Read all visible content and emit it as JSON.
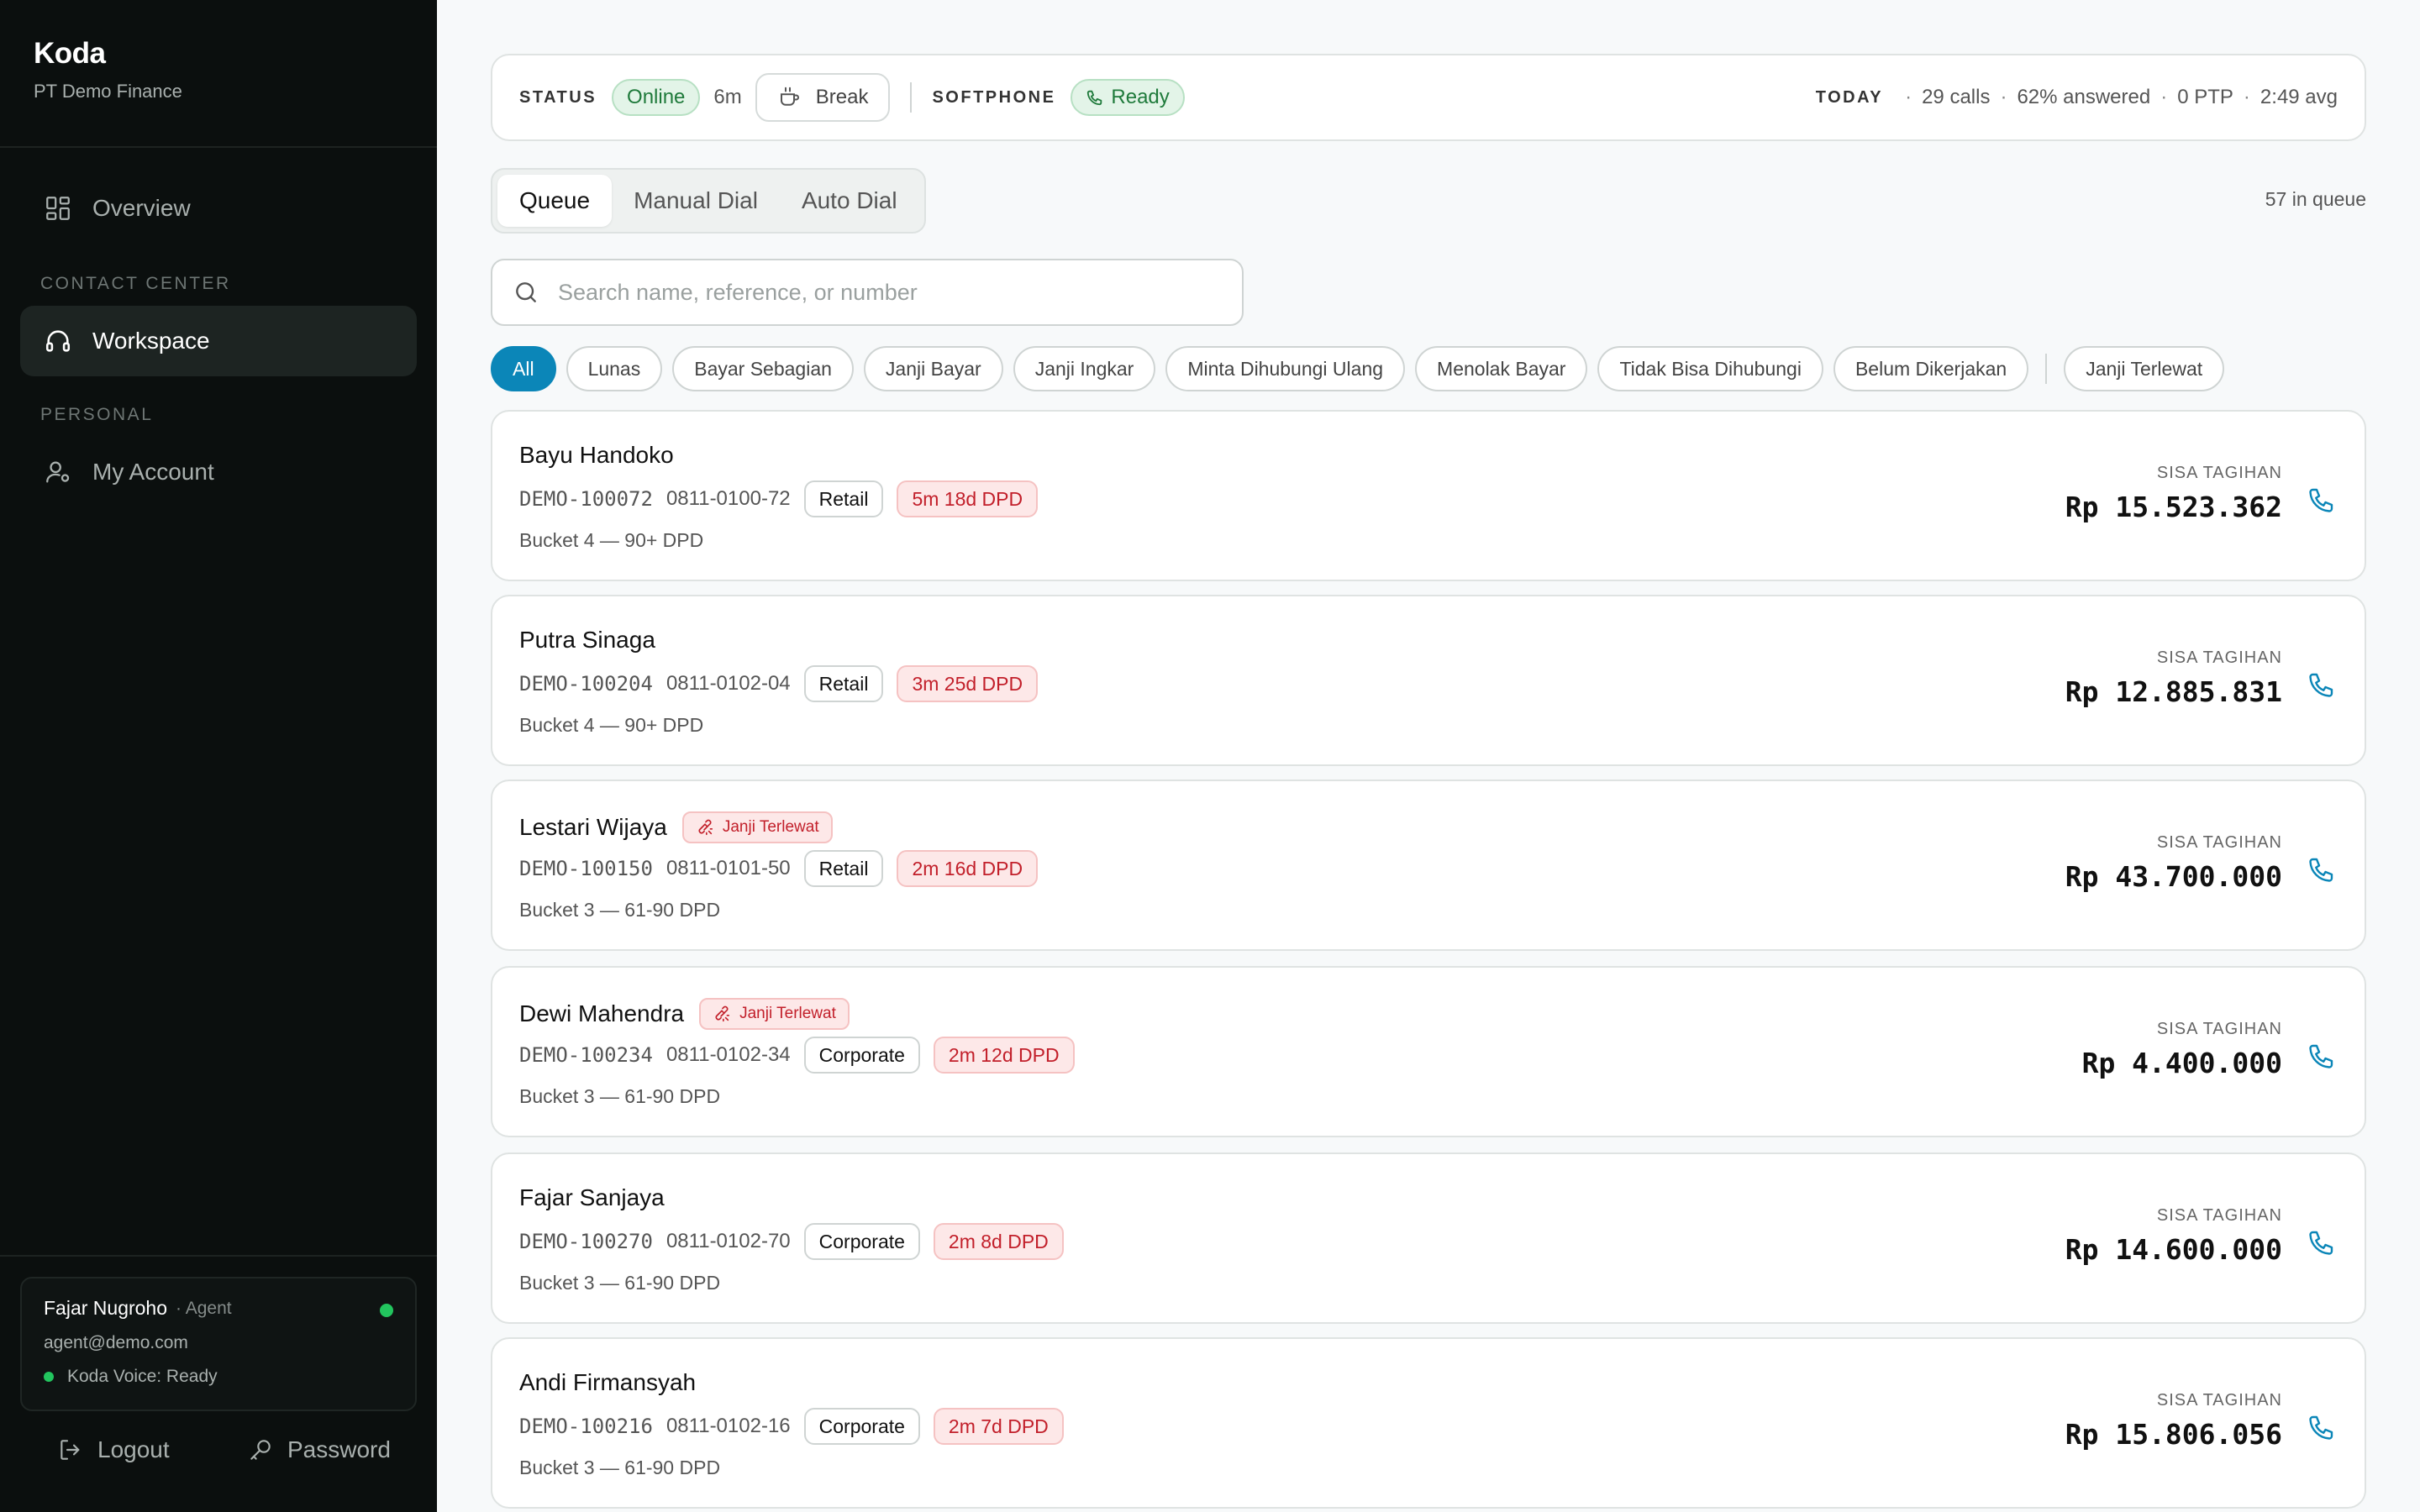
{
  "sidebar": {
    "brand": "Koda",
    "org": "PT Demo Finance",
    "overview": "Overview",
    "section_contact": "CONTACT CENTER",
    "workspace": "Workspace",
    "section_personal": "PERSONAL",
    "account": "My Account",
    "user": {
      "name": "Fajar Nugroho",
      "role": "· Agent",
      "email": "agent@demo.com",
      "voice": "Koda Voice: Ready"
    },
    "logout": "Logout",
    "password": "Password"
  },
  "status": {
    "status_label": "STATUS",
    "online": "Online",
    "duration": "6m",
    "break": "Break",
    "softphone_label": "SOFTPHONE",
    "ready": "Ready",
    "today_label": "TODAY",
    "calls": "29 calls",
    "answered": "62% answered",
    "ptp": "0 PTP",
    "avg": "2:49 avg"
  },
  "tabs": [
    "Queue",
    "Manual Dial",
    "Auto Dial"
  ],
  "queue_count": "57 in queue",
  "search": {
    "placeholder": "Search name, reference, or number"
  },
  "filters": [
    "All",
    "Lunas",
    "Bayar Sebagian",
    "Janji Bayar",
    "Janji Ingkar",
    "Minta Dihubungi Ulang",
    "Menolak Bayar",
    "Tidak Bisa Dihubungi",
    "Belum Dikerjakan"
  ],
  "filter_extra": "Janji Terlewat",
  "balance_label": "SISA TAGIHAN",
  "accounts": [
    {
      "name": "Bayu Handoko",
      "badge": "",
      "ref": "DEMO-100072",
      "phone": "0811-0100-72",
      "segment": "Retail",
      "dpd": "5m 18d DPD",
      "bucket": "Bucket 4 — 90+ DPD",
      "amount": "Rp 15.523.362"
    },
    {
      "name": "Putra Sinaga",
      "badge": "",
      "ref": "DEMO-100204",
      "phone": "0811-0102-04",
      "segment": "Retail",
      "dpd": "3m 25d DPD",
      "bucket": "Bucket 4 — 90+ DPD",
      "amount": "Rp 12.885.831"
    },
    {
      "name": "Lestari Wijaya",
      "badge": "Janji Terlewat",
      "ref": "DEMO-100150",
      "phone": "0811-0101-50",
      "segment": "Retail",
      "dpd": "2m 16d DPD",
      "bucket": "Bucket 3 — 61-90 DPD",
      "amount": "Rp 43.700.000"
    },
    {
      "name": "Dewi Mahendra",
      "badge": "Janji Terlewat",
      "ref": "DEMO-100234",
      "phone": "0811-0102-34",
      "segment": "Corporate",
      "dpd": "2m 12d DPD",
      "bucket": "Bucket 3 — 61-90 DPD",
      "amount": "Rp 4.400.000"
    },
    {
      "name": "Fajar Sanjaya",
      "badge": "",
      "ref": "DEMO-100270",
      "phone": "0811-0102-70",
      "segment": "Corporate",
      "dpd": "2m 8d DPD",
      "bucket": "Bucket 3 — 61-90 DPD",
      "amount": "Rp 14.600.000"
    },
    {
      "name": "Andi Firmansyah",
      "badge": "",
      "ref": "DEMO-100216",
      "phone": "0811-0102-16",
      "segment": "Corporate",
      "dpd": "2m 7d DPD",
      "bucket": "Bucket 3 — 61-90 DPD",
      "amount": "Rp 15.806.056"
    }
  ],
  "colors": {
    "accent": "#0b86b8",
    "danger": "#c21f2a",
    "success": "#1f7a3b",
    "sidebar": "#0b0f0e"
  }
}
